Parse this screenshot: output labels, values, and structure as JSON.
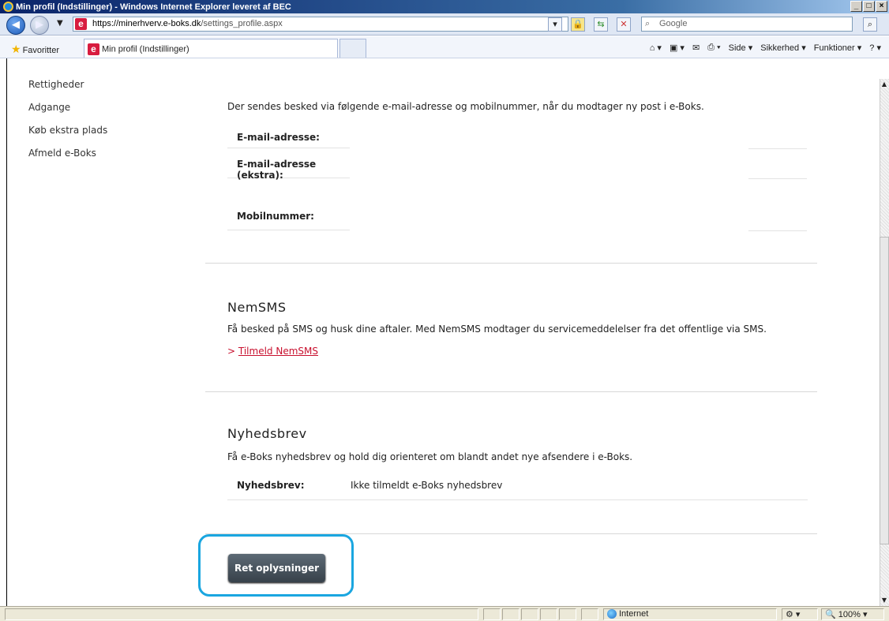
{
  "window": {
    "title": "Min profil (Indstillinger) - Windows Internet Explorer leveret af BEC"
  },
  "address": {
    "prefix": "https://",
    "host": "minerhverv.e-boks.dk",
    "path": "/settings_profile.aspx",
    "search_placeholder": "Google"
  },
  "favorites": {
    "label": "Favoritter",
    "tab_title": "Min profil (Indstillinger)"
  },
  "commandbar": {
    "side": "Side ▾",
    "sikkerhed": "Sikkerhed ▾",
    "funktioner": "Funktioner ▾"
  },
  "sidebar": {
    "items": [
      "Rettigheder",
      "Adgange",
      "Køb ekstra plads",
      "Afmeld e-Boks"
    ]
  },
  "notify": {
    "intro": "Der sendes besked via følgende e-mail-adresse og mobilnummer, når du modtager ny post i e-Boks.",
    "email_label": "E-mail-adresse:",
    "email_extra_label": "E-mail-adresse (ekstra):",
    "mobile_label": "Mobilnummer:"
  },
  "nemsms": {
    "title": "NemSMS",
    "text": "Få besked på SMS og husk dine aftaler. Med NemSMS modtager du servicemeddelelser fra det offentlige via SMS.",
    "link": "Tilmeld NemSMS"
  },
  "newsletter": {
    "title": "Nyhedsbrev",
    "text": "Få e-Boks nyhedsbrev og hold dig orienteret om blandt andet nye afsendere i e-Boks.",
    "label": "Nyhedsbrev:",
    "value": "Ikke tilmeldt e-Boks nyhedsbrev"
  },
  "button": {
    "label": "Ret oplysninger"
  },
  "status": {
    "zone": "Internet",
    "zoom": "100%"
  }
}
